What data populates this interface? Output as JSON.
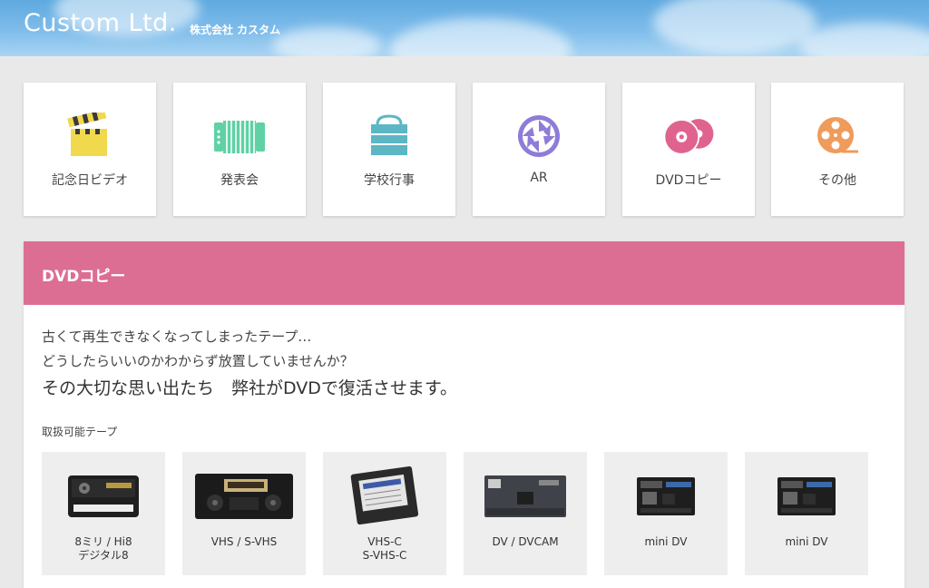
{
  "header": {
    "logo_en": "Custom Ltd.",
    "logo_jp": "株式会社 カスタム"
  },
  "categories": [
    {
      "label": "記念日ビデオ",
      "icon": "clapperboard-icon",
      "color": "#f1d94e"
    },
    {
      "label": "発表会",
      "icon": "accordion-icon",
      "color": "#5fd1a5"
    },
    {
      "label": "学校行事",
      "icon": "school-bag-icon",
      "color": "#5db6c4"
    },
    {
      "label": "AR",
      "icon": "camera-shutter-icon",
      "color": "#8e7cd8"
    },
    {
      "label": "DVDコピー",
      "icon": "disc-icon",
      "color": "#e0638f"
    },
    {
      "label": "その他",
      "icon": "film-reel-icon",
      "color": "#ef9b5b"
    }
  ],
  "section": {
    "title": "DVDコピー",
    "accent": "#dc6e93",
    "intro_line1": "古くて再生できなくなってしまったテープ…",
    "intro_line2": "どうしたらいいのかわからず放置していませんか？",
    "intro_line3": "その大切な思い出たち　弊社がDVDで復活させます。",
    "tapes_title": "取扱可能テープ",
    "tapes": [
      {
        "label": "8ミリ / Hi8\nデジタル8",
        "icon": "8mm-tape-icon"
      },
      {
        "label": "VHS / S-VHS",
        "icon": "vhs-tape-icon"
      },
      {
        "label": "VHS-C\nS-VHS-C",
        "icon": "vhs-c-tape-icon"
      },
      {
        "label": "DV / DVCAM",
        "icon": "dv-tape-icon"
      },
      {
        "label": "mini DV",
        "icon": "mini-dv-tape-icon"
      },
      {
        "label": "mini DV",
        "icon": "mini-dv-tape-icon"
      }
    ]
  }
}
